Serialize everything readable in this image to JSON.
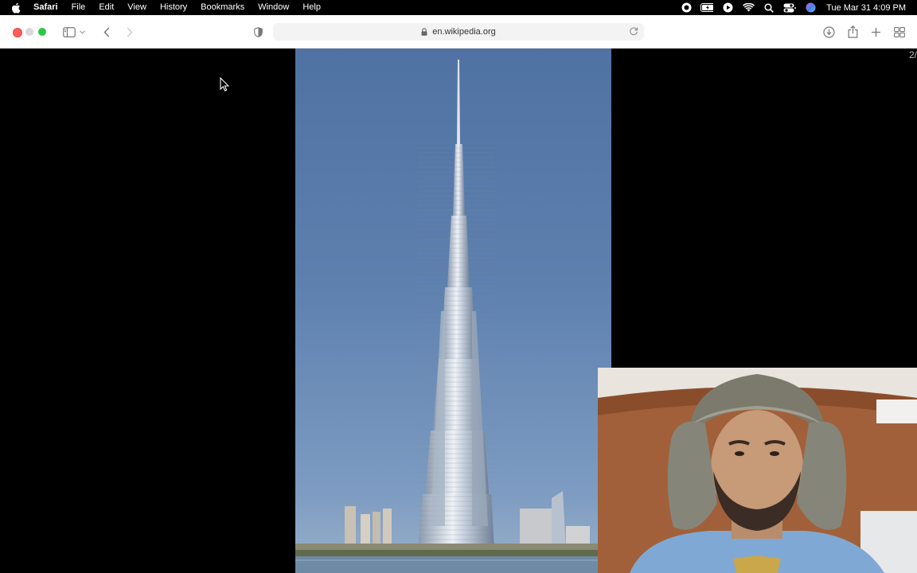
{
  "menubar": {
    "app_name": "Safari",
    "items": [
      "File",
      "Edit",
      "View",
      "History",
      "Bookmarks",
      "Window",
      "Help"
    ],
    "clock": "Tue Mar 31  4:09 PM"
  },
  "toolbar": {
    "url": "en.wikipedia.org"
  },
  "viewer": {
    "counter": "2/"
  },
  "colors": {
    "sky": "#5d80af",
    "close": "#ff5f57",
    "maximize": "#28c840"
  }
}
